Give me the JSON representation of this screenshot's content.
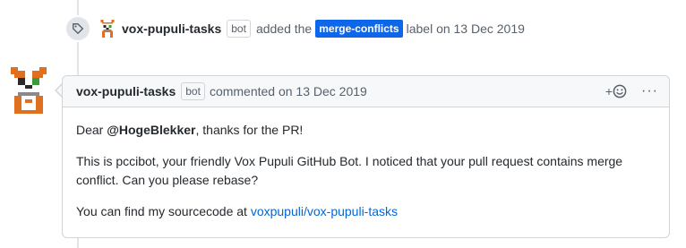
{
  "event": {
    "actor": "vox-pupuli-tasks",
    "bot_badge": "bot",
    "action": "added the",
    "label": "merge-conflicts",
    "suffix": "label on 13 Dec 2019",
    "label_color": "#0e66e8",
    "icon": "tag-icon"
  },
  "comment": {
    "author": "vox-pupuli-tasks",
    "bot_badge": "bot",
    "meta": "commented on 13 Dec 2019",
    "actions": {
      "reaction_icon": "add-reaction-icon",
      "reaction_plus": "+",
      "menu_icon": "kebab-horizontal-icon",
      "menu_glyph": "···"
    },
    "body": {
      "greeting_prefix": "Dear ",
      "mention": "@HogeBlekker",
      "greeting_suffix": ", thanks for the PR!",
      "paragraph2": "This is pccibot, your friendly Vox Pupuli GitHub Bot. I noticed that your pull request contains merge conflict. Can you please rebase?",
      "source_prefix": "You can find my sourcecode at ",
      "source_link": "voxpupuli/vox-pupuli-tasks"
    }
  },
  "colors": {
    "link": "#0366d6",
    "header_bg": "#f6f8fa",
    "border": "#d1d5da"
  }
}
